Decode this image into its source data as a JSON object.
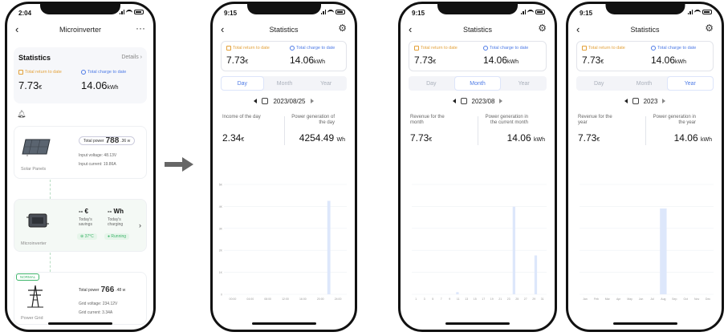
{
  "screen1": {
    "time": "2:04",
    "title": "Microinverter",
    "more_icon": "more-horizontal-icon",
    "statistics": {
      "title": "Statistics",
      "details": "Details",
      "total_return_label": "Total return to date",
      "total_return_value": "7.73",
      "total_return_unit": "€",
      "total_charge_label": "Total charge to date",
      "total_charge_value": "14.06",
      "total_charge_unit": "kWh"
    },
    "solar": {
      "name": "Solar Panels",
      "total_power_label": "Total power",
      "total_power_value": "788",
      "total_power_unit": ".36 w",
      "input_voltage": "Input voltage: 48.13V",
      "input_current": "Input current: 19.86A"
    },
    "inverter": {
      "name": "Microinverter",
      "today_savings_value": "-- €",
      "today_savings_label": "Today's savings",
      "today_charging_value": "-- Wh",
      "today_charging_label": "Today's charging",
      "temperature": "⊕ 37°C",
      "status": "● Running"
    },
    "grid": {
      "name": "Power Grid",
      "badge": "NORMAL",
      "total_power_label": "Total power",
      "total_power_value": "766",
      "total_power_unit": ".48 w",
      "grid_voltage": "Grid voltage: 234.12V",
      "grid_current": "Grid current: 3.34A"
    }
  },
  "screen2": {
    "time": "9:15",
    "title": "Statistics",
    "total_return_label": "Total return to date",
    "total_return_value": "7.73",
    "total_return_unit": "€",
    "total_charge_label": "Total charge to date",
    "total_charge_value": "14.06",
    "total_charge_unit": "kWh",
    "tabs": [
      "Day",
      "Month",
      "Year"
    ],
    "active_tab": 0,
    "date": "2023/08/25",
    "left_metric_label": "Income of the day",
    "left_metric_value": "2.34",
    "left_metric_unit": "€",
    "right_metric_label": "Power generation of the day",
    "right_metric_value": "4254.49",
    "right_metric_unit": "Wh"
  },
  "screen3": {
    "time": "9:15",
    "title": "Statistics",
    "total_return_label": "Total return to date",
    "total_return_value": "7.73",
    "total_return_unit": "€",
    "total_charge_label": "Total charge to date",
    "total_charge_value": "14.06",
    "total_charge_unit": "kWh",
    "tabs": [
      "Day",
      "Month",
      "Year"
    ],
    "active_tab": 1,
    "date": "2023/08",
    "left_metric_label": "Revenue for the month",
    "left_metric_value": "7.73",
    "left_metric_unit": "€",
    "right_metric_label": "Power generation in the current month",
    "right_metric_value": "14.06",
    "right_metric_unit": "kWh"
  },
  "screen4": {
    "time": "9:15",
    "title": "Statistics",
    "total_return_label": "Total return to date",
    "total_return_value": "7.73",
    "total_return_unit": "€",
    "total_charge_label": "Total charge to date",
    "total_charge_value": "14.06",
    "total_charge_unit": "kWh",
    "tabs": [
      "Day",
      "Month",
      "Year"
    ],
    "active_tab": 2,
    "date": "2023",
    "left_metric_label": "Revenue for the year",
    "left_metric_value": "7.73",
    "left_metric_unit": "€",
    "right_metric_label": "Power generation in the year",
    "right_metric_value": "14.06",
    "right_metric_unit": "kWh"
  },
  "colors": {
    "accent_blue": "#4e7be6",
    "gold": "#e3a13a",
    "bar": "#dde7fb",
    "running_green": "#3fb56b"
  },
  "chart_data": [
    {
      "type": "bar",
      "panel": "Day",
      "x": [
        "00:00",
        "04:00",
        "08:00",
        "12:00",
        "16:00",
        "20:00",
        "24:00"
      ],
      "bar_categories": [
        0,
        1,
        2,
        3,
        4,
        5,
        6,
        7,
        8,
        9,
        10,
        11,
        12,
        13,
        14,
        15,
        16,
        17,
        18,
        19,
        20,
        21,
        22,
        23
      ],
      "values": [
        0,
        0,
        0,
        0,
        0,
        0,
        0,
        0,
        0,
        0,
        0,
        0,
        0,
        0,
        0,
        0,
        0,
        0,
        0,
        0,
        4254.49,
        0,
        0,
        0
      ],
      "yticks": [
        "5K",
        "4K",
        "3K",
        "2K",
        "1K",
        "0"
      ],
      "ylim": [
        0,
        5000
      ]
    },
    {
      "type": "bar",
      "panel": "Month",
      "x": [
        "1",
        "3",
        "5",
        "7",
        "9",
        "11",
        "13",
        "15",
        "17",
        "19",
        "21",
        "23",
        "25",
        "27",
        "29",
        "31"
      ],
      "bar_categories": [
        1,
        2,
        3,
        4,
        5,
        6,
        7,
        8,
        9,
        10,
        11,
        12,
        13,
        14,
        15,
        16,
        17,
        18,
        19,
        20,
        21,
        22,
        23,
        24,
        25,
        26,
        27,
        28,
        29,
        30,
        31
      ],
      "values": [
        0,
        0,
        0,
        0,
        0,
        0,
        0,
        0,
        0,
        0,
        0.24,
        0,
        0,
        0,
        0,
        0,
        0,
        0,
        0,
        0,
        0,
        0,
        0,
        9.57,
        0,
        0,
        0,
        0,
        4.25,
        0,
        0
      ],
      "ylim": [
        0,
        12
      ]
    },
    {
      "type": "bar",
      "panel": "Year",
      "x": [
        "Jan",
        "Feb",
        "Mar",
        "Apr",
        "May",
        "Jun",
        "Jul",
        "Aug",
        "Sep",
        "Oct",
        "Nov",
        "Dec"
      ],
      "values": [
        0,
        0,
        0,
        0,
        0,
        0,
        0,
        14.06,
        0,
        0,
        0,
        0
      ],
      "ylim": [
        0,
        18
      ]
    }
  ]
}
